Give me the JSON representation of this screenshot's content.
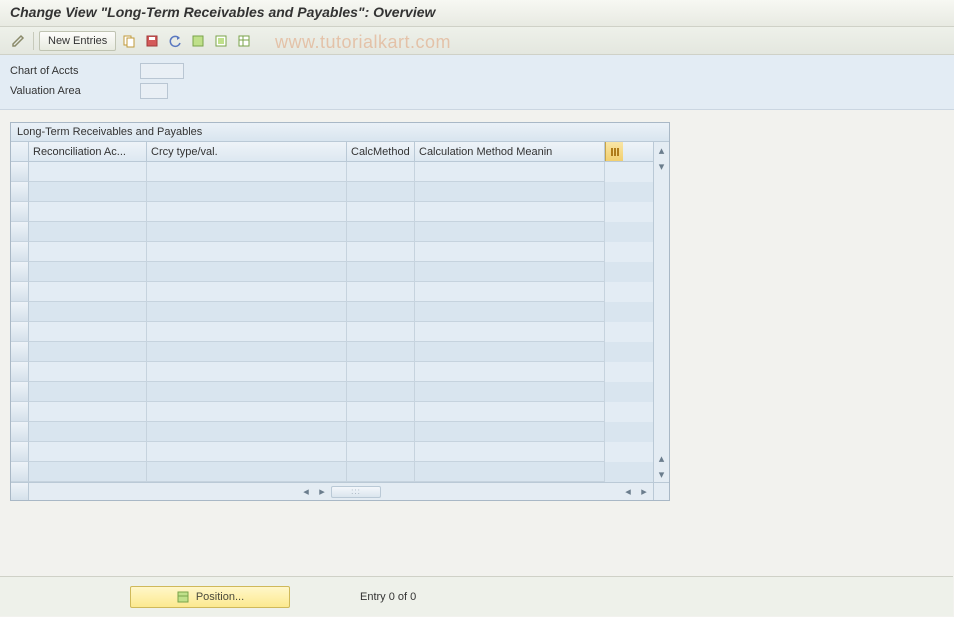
{
  "title": "Change View \"Long-Term Receivables and Payables\": Overview",
  "toolbar": {
    "new_entries_label": "New Entries"
  },
  "watermark": "www.tutorialkart.com",
  "filters": {
    "chart_of_accts_label": "Chart of Accts",
    "chart_of_accts_value": "",
    "valuation_area_label": "Valuation Area",
    "valuation_area_value": ""
  },
  "table": {
    "title": "Long-Term Receivables and Payables",
    "columns": {
      "reconciliation": "Reconciliation Ac...",
      "crcy": "Crcy type/val.",
      "calcmethod": "CalcMethod",
      "meaning": "Calculation Method Meanin"
    },
    "row_count": 16
  },
  "footer": {
    "position_label": "Position...",
    "entry_text": "Entry 0 of 0"
  }
}
